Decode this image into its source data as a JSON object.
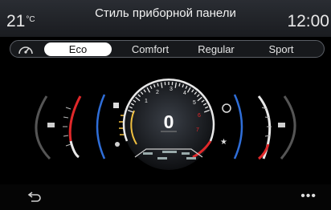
{
  "header": {
    "temperature": "21",
    "temperature_unit": "°C",
    "title": "Стиль приборной панели",
    "time": "12:00"
  },
  "tabs": [
    {
      "label": "Eco",
      "active": true
    },
    {
      "label": "Comfort",
      "active": false
    },
    {
      "label": "Regular",
      "active": false
    },
    {
      "label": "Sport",
      "active": false
    }
  ],
  "cluster": {
    "speed": "0",
    "tacho_ticks": [
      "1",
      "2",
      "3",
      "4",
      "5",
      "6",
      "7"
    ]
  },
  "colors": {
    "accent_blue": "#2f6ed8",
    "redline": "#e0282a",
    "gauge_white": "#e8e8e8"
  },
  "icons": {
    "back": "back-arrow-icon",
    "more": "more-icon",
    "dashboard": "speedometer-icon"
  },
  "footer": {
    "more_label": "•••"
  }
}
